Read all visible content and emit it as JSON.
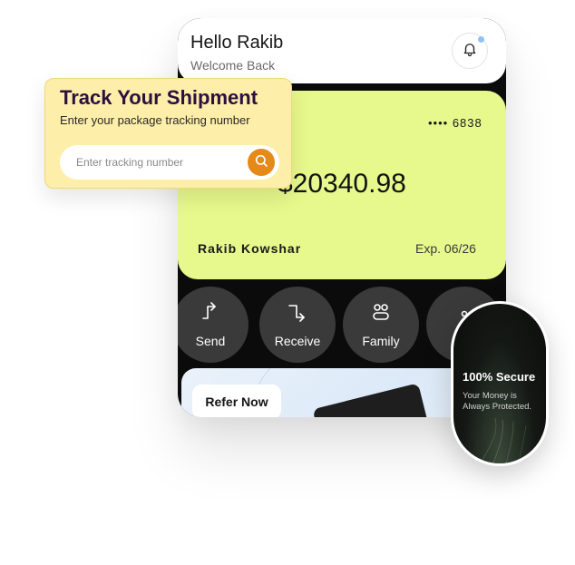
{
  "header": {
    "greeting": "Hello Rakib",
    "subtitle": "Welcome Back",
    "notification_icon": "bell-icon"
  },
  "card": {
    "masked_number": "•••• 6838",
    "balance": "$20340.98",
    "holder_name": "Rakib Kowshar",
    "expiry": "Exp. 06/26",
    "color": "#e7f88c"
  },
  "actions": [
    {
      "label": "Send",
      "icon": "send-arrow-icon"
    },
    {
      "label": "Receive",
      "icon": "receive-arrow-icon"
    },
    {
      "label": "Family",
      "icon": "family-icon"
    },
    {
      "label": "",
      "icon": "more-icon"
    }
  ],
  "refer": {
    "button_label": "Refer Now"
  },
  "tracking": {
    "title": "Track Your Shipment",
    "subtitle": "Enter your package tracking number",
    "input_placeholder": "Enter tracking number",
    "input_value": "",
    "search_icon": "search-icon",
    "accent": "#e58a18",
    "background": "#fdeea9"
  },
  "security": {
    "title": "100% Secure",
    "description": "Your Money is Always Protected."
  }
}
